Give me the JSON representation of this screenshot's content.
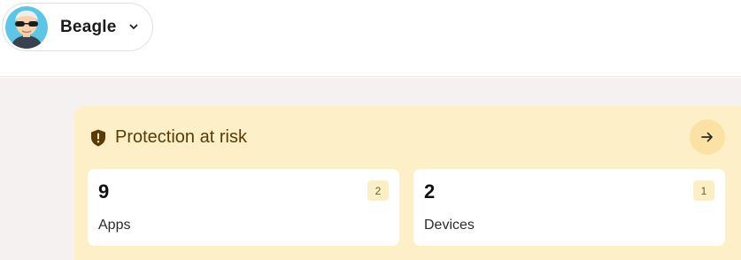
{
  "account": {
    "name": "Beagle"
  },
  "risk_card": {
    "title": "Protection at risk",
    "accent_color": "#fdf0c9",
    "tiles": [
      {
        "count": "9",
        "badge": "2",
        "label": "Apps"
      },
      {
        "count": "2",
        "badge": "1",
        "label": "Devices"
      }
    ]
  },
  "icons": {
    "avatar": "user-avatar-sunglasses",
    "account_chevron": "chevron-down-icon",
    "risk": "shield-alert-icon",
    "navigate": "arrow-right-icon"
  }
}
